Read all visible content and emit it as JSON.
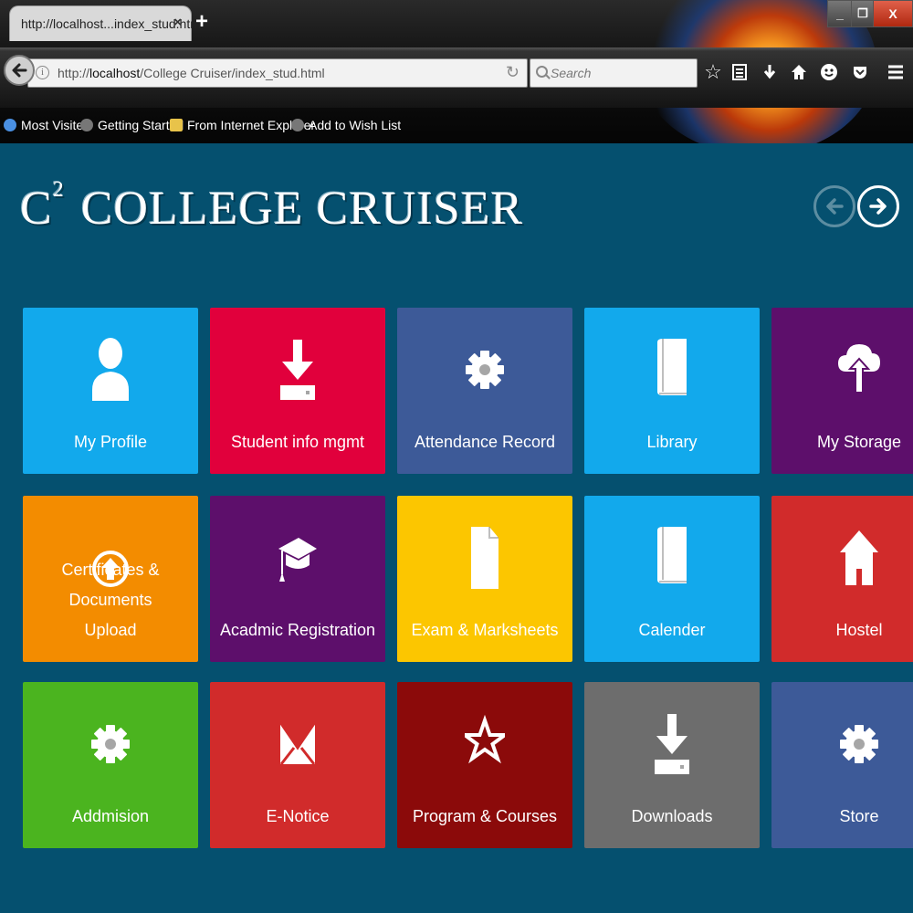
{
  "browser": {
    "tab_title": "http://localhost...index_stud.html",
    "tab_close": "×",
    "new_tab": "+",
    "window": {
      "minimize": "_",
      "maximize": "❐",
      "close": "X"
    },
    "url_prefix": "http://",
    "url_host": "localhost",
    "url_path": "/College Cruiser/index_stud.html",
    "search_placeholder": "Search",
    "bookmarks": [
      {
        "label": "Most Visited",
        "icon": "most-visited-icon",
        "color": "#4a90e2"
      },
      {
        "label": "Getting Started",
        "icon": "firefox-icon",
        "color": "#777777"
      },
      {
        "label": "From Internet Explorer",
        "icon": "folder-icon",
        "color": "#e8c34a"
      },
      {
        "label": "Add to Wish List",
        "icon": "firefox-icon",
        "color": "#777777"
      }
    ]
  },
  "app": {
    "brand_mark": "C",
    "brand_sup": "2",
    "brand_name": "COLLEGE CRUISER",
    "background_color": "#05506f"
  },
  "tiles": [
    {
      "label": "My Profile",
      "color": "#12a9ec",
      "icon": "user-icon"
    },
    {
      "label": "Student info mgmt",
      "color": "#e1003c",
      "icon": "download-icon"
    },
    {
      "label": "Attendance Record",
      "color": "#3d5a98",
      "icon": "gear-icon"
    },
    {
      "label": "Library",
      "color": "#12a9ec",
      "icon": "book-icon"
    },
    {
      "label": "My Storage",
      "color": "#5d0f6b",
      "icon": "cloud-upload-icon"
    },
    {
      "label_lines": [
        "Certificates & Documents",
        "Upload"
      ],
      "color": "#f38c00",
      "icon": "upload-circle-icon"
    },
    {
      "label": "Acadmic Registration",
      "color": "#5d0f6b",
      "icon": "graduation-cap-icon"
    },
    {
      "label": "Exam & Marksheets",
      "color": "#fcc600",
      "icon": "document-icon"
    },
    {
      "label": "Calender",
      "color": "#12a9ec",
      "icon": "book-icon"
    },
    {
      "label": "Hostel",
      "color": "#d12b2b",
      "icon": "home-icon"
    },
    {
      "label": "Addmision",
      "color": "#4bb41f",
      "icon": "gear-icon"
    },
    {
      "label": "E-Notice",
      "color": "#d12b2b",
      "icon": "mail-icon"
    },
    {
      "label": "Program & Courses",
      "color": "#8b0a0a",
      "icon": "star-icon"
    },
    {
      "label": "Downloads",
      "color": "#6d6d6d",
      "icon": "download-icon"
    },
    {
      "label": "Store",
      "color": "#3d5a98",
      "icon": "gear-icon"
    }
  ]
}
